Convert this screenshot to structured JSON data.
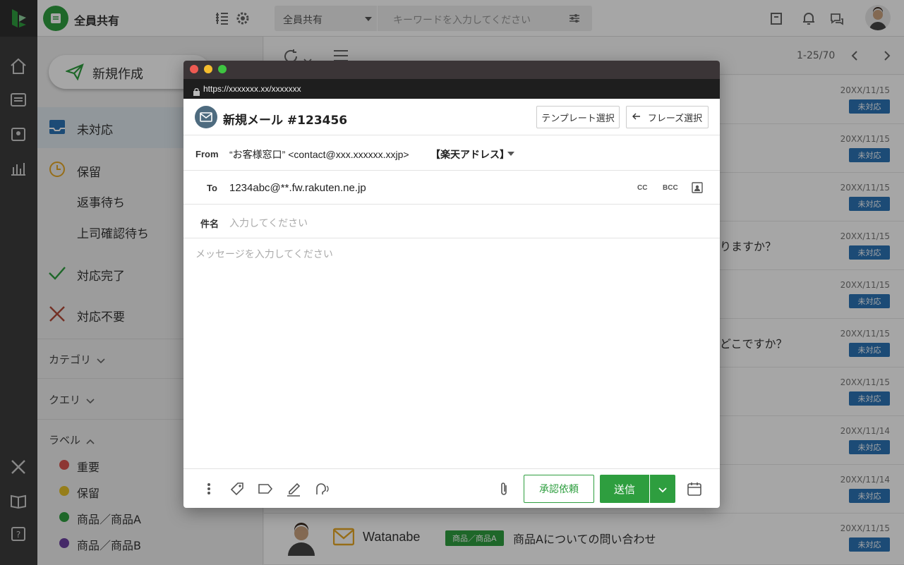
{
  "workspace": {
    "name": "全員共有"
  },
  "topbar": {
    "filter_value": "全員共有",
    "keyword_placeholder": "キーワードを入力してください"
  },
  "sidebar": {
    "new_button": "新規作成",
    "nav": [
      {
        "label": "未対応",
        "icon": "inbox-icon",
        "active": true
      },
      {
        "label": "保留",
        "icon": "clock-icon"
      },
      {
        "label": "返事待ち"
      },
      {
        "label": "上司確認待ち"
      },
      {
        "label": "対応完了",
        "icon": "check-icon"
      },
      {
        "label": "対応不要",
        "icon": "x-icon"
      }
    ],
    "sections": {
      "category": "カテゴリ",
      "query": "クエリ",
      "label": "ラベル"
    },
    "labels": [
      {
        "name": "重要",
        "color": "#d9534f"
      },
      {
        "name": "保留",
        "color": "#e6c229"
      },
      {
        "name": "商品／商品A",
        "color": "#2e9e3f"
      },
      {
        "name": "商品／商品B",
        "color": "#6a3fa0"
      }
    ]
  },
  "list": {
    "pager": "1-25/70",
    "rows": [
      {
        "date": "20XX/11/15",
        "status": "未対応",
        "snippet": ""
      },
      {
        "date": "20XX/11/15",
        "status": "未対応",
        "snippet": ""
      },
      {
        "date": "20XX/11/15",
        "status": "未対応",
        "snippet": ""
      },
      {
        "date": "20XX/11/15",
        "status": "未対応",
        "snippet": "りますか？"
      },
      {
        "date": "20XX/11/15",
        "status": "未対応",
        "snippet": ""
      },
      {
        "date": "20XX/11/15",
        "status": "未対応",
        "snippet": "どこですか？"
      },
      {
        "date": "20XX/11/15",
        "status": "未対応",
        "snippet": ""
      },
      {
        "date": "20XX/11/14",
        "status": "未対応",
        "snippet": ""
      },
      {
        "date": "20XX/11/14",
        "status": "未対応",
        "snippet": ""
      },
      {
        "date": "20XX/11/15",
        "status": "未対応",
        "sender": "Watanabe",
        "tag": "商品／商品A",
        "subject": "商品Aについての問い合わせ"
      }
    ]
  },
  "modal": {
    "url": "https://xxxxxxx.xx/xxxxxxx",
    "title": "新規メール #123456",
    "template_button": "テンプレート選択",
    "phrase_button": "フレーズ選択",
    "from_label": "From",
    "from_value": "“お客様窓口” <contact@xxx.xxxxxx.xxjp>",
    "from_account": "【楽天アドレス】",
    "to_label": "To",
    "to_value": "1234abc@**.fw.rakuten.ne.jp",
    "cc_label": "CC",
    "bcc_label": "BCC",
    "subject_label": "件名",
    "subject_placeholder": "入力してください",
    "body_placeholder": "メッセージを入力してください",
    "approve_button": "承認依頼",
    "send_button": "送信"
  },
  "colors": {
    "brand_green": "#2e9e3f",
    "status_blue": "#2b73b5",
    "rail": "#3d3d3d"
  }
}
